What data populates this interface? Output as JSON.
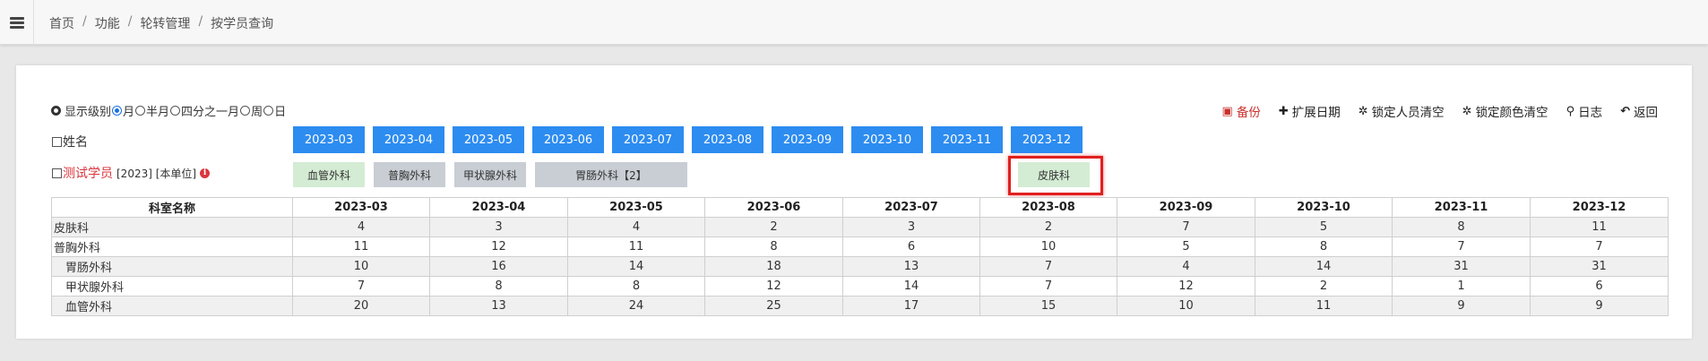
{
  "breadcrumb": [
    "首页",
    "功能",
    "轮转管理",
    "按学员查询"
  ],
  "level": {
    "label": "显示级别",
    "options": [
      "月",
      "半月",
      "四分之一月",
      "周",
      "日"
    ],
    "selected": 0
  },
  "actions": {
    "backup": "备份",
    "extend_date": "扩展日期",
    "lock_person_clear": "锁定人员清空",
    "lock_color_clear": "锁定颜色清空",
    "log": "日志",
    "back": "返回"
  },
  "name_label": "姓名",
  "months": [
    "2023-03",
    "2023-04",
    "2023-05",
    "2023-06",
    "2023-07",
    "2023-08",
    "2023-09",
    "2023-10",
    "2023-11",
    "2023-12"
  ],
  "student": {
    "name": "测试学员",
    "meta": "[2023] [本单位]"
  },
  "rotations": [
    {
      "label": "血管外科",
      "style": "green"
    },
    {
      "label": "普胸外科",
      "style": "gray"
    },
    {
      "label": "甲状腺外科",
      "style": "gray"
    },
    {
      "label": "胃肠外科【2】",
      "style": "gray"
    },
    {
      "label": "皮肤科",
      "style": "green"
    }
  ],
  "table": {
    "header_dept": "科室名称",
    "rows": [
      {
        "dept": "皮肤科",
        "child": false,
        "values": [
          "4",
          "3",
          "4",
          "2",
          "3",
          "2",
          "7",
          "5",
          "8",
          "11"
        ]
      },
      {
        "dept": "普胸外科",
        "child": false,
        "values": [
          "11",
          "12",
          "11",
          "8",
          "6",
          "10",
          "5",
          "8",
          "7",
          "7"
        ]
      },
      {
        "dept": "胃肠外科",
        "child": true,
        "values": [
          "10",
          "16",
          "14",
          "18",
          "13",
          "7",
          "4",
          "14",
          "31",
          "31"
        ]
      },
      {
        "dept": "甲状腺外科",
        "child": true,
        "values": [
          "7",
          "8",
          "8",
          "12",
          "14",
          "7",
          "12",
          "2",
          "1",
          "6"
        ]
      },
      {
        "dept": "血管外科",
        "child": true,
        "values": [
          "20",
          "13",
          "24",
          "25",
          "17",
          "15",
          "10",
          "11",
          "9",
          "9"
        ]
      }
    ]
  },
  "colors": {
    "accent": "#2d8cf0",
    "danger": "#d9363e",
    "highlight": "#e0201e",
    "green_block": "#d4ecd4",
    "gray_block": "#c8ced4"
  }
}
